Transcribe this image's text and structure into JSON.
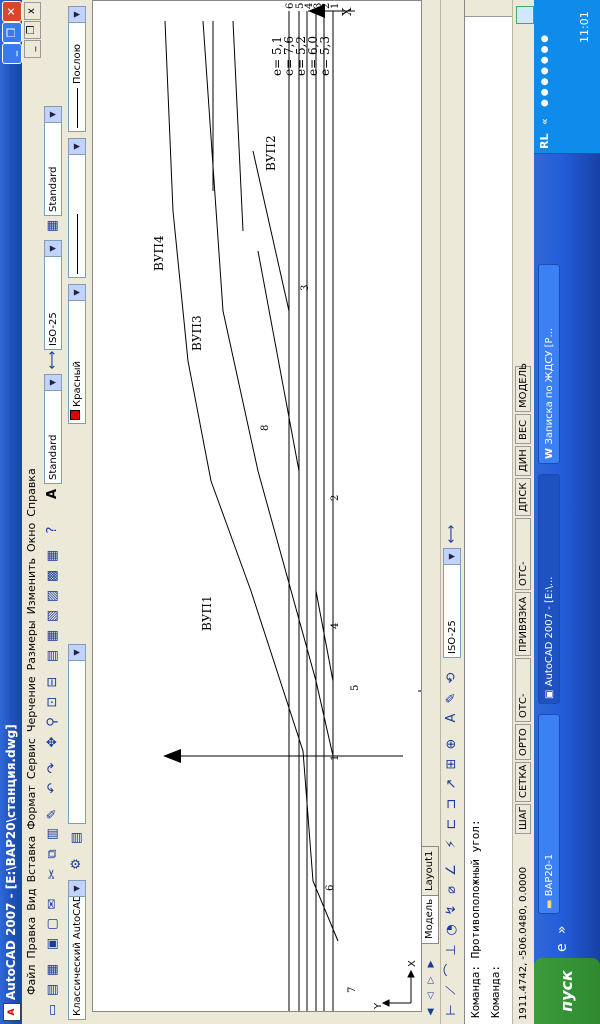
{
  "window": {
    "title": "AutoCAD 2007 - [E:\\ВАР20\\станция.dwg]",
    "min_label": "_",
    "restore_label": "❐",
    "close_label": "✕"
  },
  "menus": [
    "Файл",
    "Правка",
    "Вид",
    "Вставка",
    "Формат",
    "Сервис",
    "Черчение",
    "Размеры",
    "Изменить",
    "Окно",
    "Справка"
  ],
  "toolbar": {
    "workspace": "Классический AutoCAD",
    "text_style": "Standard",
    "dim_style": "ISO-25",
    "table_style": "Standard",
    "color": "Красный",
    "linetype": "Послою",
    "dim_style2": "ISO-25"
  },
  "drawing": {
    "labels": {
      "vup1": "ВУП1",
      "vup2": "ВУП2",
      "vup3": "ВУП3",
      "vup4": "ВУП4",
      "e1": "e= 5,1",
      "e2": "e= 7,6",
      "e3": "e= 5,2",
      "e4": "e= 6,0",
      "e5": "e= 5,3",
      "n1": "1",
      "n2": "2",
      "n3": "3",
      "n4": "4",
      "n5": "5",
      "n6": "6",
      "n7": "7",
      "n8": "8",
      "t1": "1",
      "t2": "2",
      "t3": "3",
      "t4": "4",
      "t5": "5",
      "t6": "6",
      "axis_x": "X",
      "ucs_x": "X",
      "ucs_y": "Y"
    }
  },
  "tabs": [
    "Модель",
    "Layout1"
  ],
  "command": {
    "line1": "Команда:  Противоположный угол:",
    "line2": "Команда:"
  },
  "status": {
    "coords": "1911.4742, -506.0480, 0.0000",
    "buttons": [
      "ШАГ",
      "СЕТКА",
      "ОРТО",
      "ОТС-ПОЛЯР",
      "ПРИВЯЗКА",
      "ОТС-ОБЪЕКТ",
      "ДПСК",
      "ДИН",
      "ВЕС",
      "МОДЕЛЬ"
    ]
  },
  "taskbar": {
    "start": "пуск",
    "items": [
      "ВАР20-1",
      "AutoCAD 2007 - [E:\\...",
      "Записка по ЖДСУ [Р..."
    ],
    "lang": "RL",
    "clock": "11:01"
  }
}
